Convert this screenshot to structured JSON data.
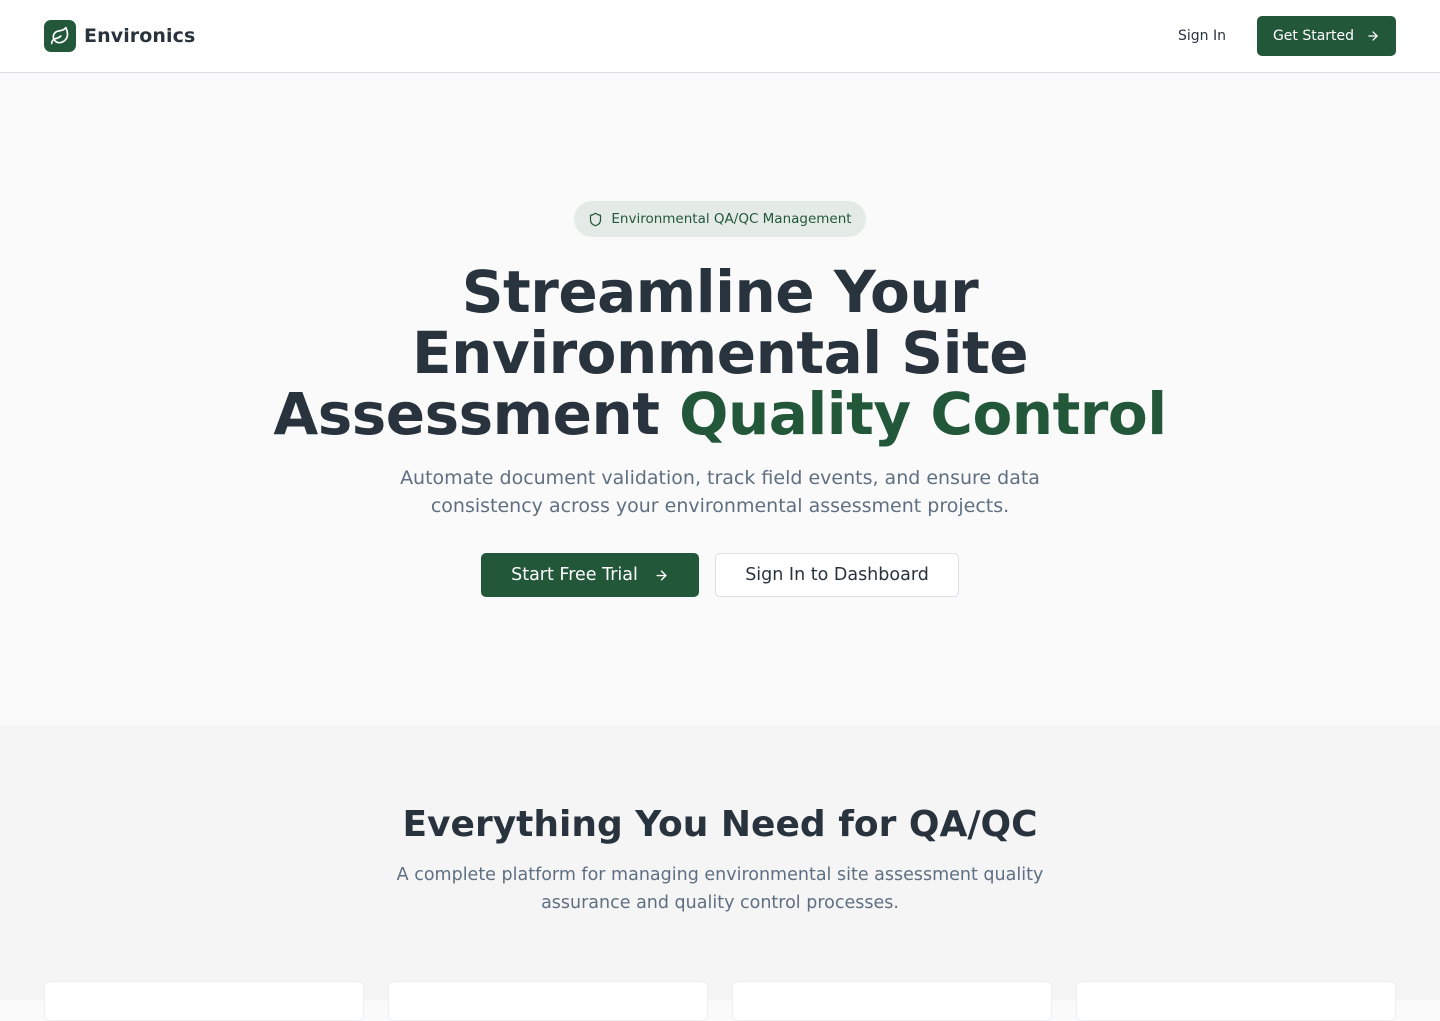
{
  "header": {
    "brand_name": "Environics",
    "brand_icon": "leaf-icon",
    "sign_in_label": "Sign In",
    "get_started_label": "Get Started"
  },
  "hero": {
    "badge_label": "Environmental QA/QC Management",
    "badge_icon": "shield-icon",
    "title_line1": "Streamline Your",
    "title_line2": "Environmental Site",
    "title_line3_plain": "Assessment ",
    "title_line3_accent": "Quality Control",
    "subtitle": "Automate document validation, track field events, and ensure data consistency across your environmental assessment projects.",
    "primary_cta_label": "Start Free Trial",
    "secondary_cta_label": "Sign In to Dashboard"
  },
  "features": {
    "title": "Everything You Need for QA/QC",
    "subtitle": "A complete platform for managing environmental site assessment quality assurance and quality control processes."
  },
  "colors": {
    "brand_green": "#23573a",
    "text_dark": "#29333d",
    "text_muted": "#5f6f82",
    "badge_bg": "#e4ebe6",
    "page_bg": "#fafafa"
  }
}
